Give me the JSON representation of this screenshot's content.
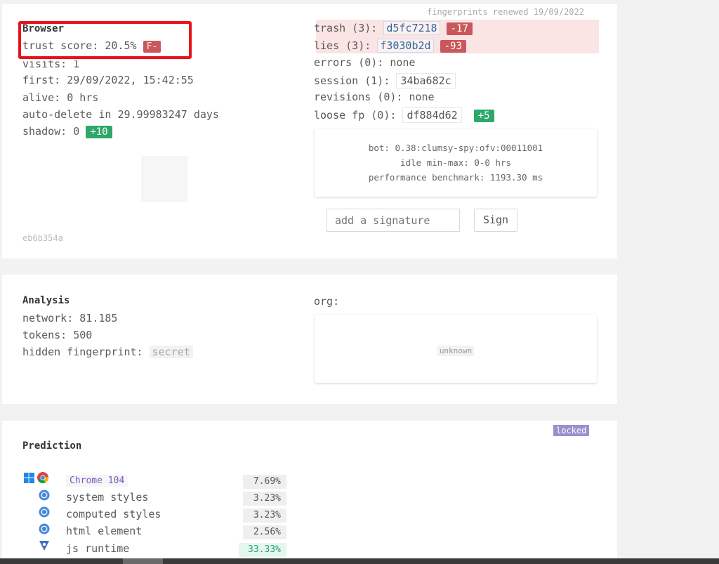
{
  "browser": {
    "heading": "Browser",
    "renewed": "fingerprints renewed 19/09/2022",
    "trust_score_label": "trust score: 20.5%",
    "grade": "F-",
    "visits": "visits: 1",
    "first": "first: 29/09/2022, 15:42:55",
    "alive": "alive: 0 hrs",
    "auto_delete": "auto-delete in 29.99983247 days",
    "shadow_label": "shadow: 0",
    "shadow_badge": "+10",
    "hash_footer": "eb6b354a",
    "trash_label": "trash (3):",
    "trash_hash": "d5fc7218",
    "trash_badge": "-17",
    "lies_label": "lies (3):",
    "lies_hash": "f3030b2d",
    "lies_badge": "-93",
    "errors": "errors (0): none",
    "session_label": "session (1):",
    "session_hash": "34ba682c",
    "revisions": "revisions (0): none",
    "loose_label": "loose fp (0):",
    "loose_hash": "df884d62",
    "loose_badge": "+5",
    "bot": "bot: 0.38:clumsy-spy:ofv:00011001",
    "idle": "idle min-max: 0-0 hrs",
    "perf": "performance benchmark: 1193.30 ms",
    "signature_placeholder": "add a signature",
    "sign_label": "Sign"
  },
  "analysis": {
    "heading": "Analysis",
    "network": "network: 81.185",
    "tokens": "tokens: 500",
    "hidden_label": "hidden fingerprint:",
    "hidden_value": "secret",
    "org_label": "org:",
    "org_value": "unknown"
  },
  "prediction": {
    "heading": "Prediction",
    "locked": "locked",
    "rows": [
      {
        "label": "Chrome 104",
        "pct": "7.69%"
      },
      {
        "label": "system styles",
        "pct": "3.23%"
      },
      {
        "label": "computed styles",
        "pct": "3.23%"
      },
      {
        "label": "html element",
        "pct": "2.56%"
      },
      {
        "label": "js runtime",
        "pct": "33.33%"
      }
    ]
  },
  "colors": {
    "highlight_box": "#e8141c",
    "badge_red": "#c9585c",
    "badge_green": "#2ea86a",
    "locked": "#9b8fd0"
  }
}
